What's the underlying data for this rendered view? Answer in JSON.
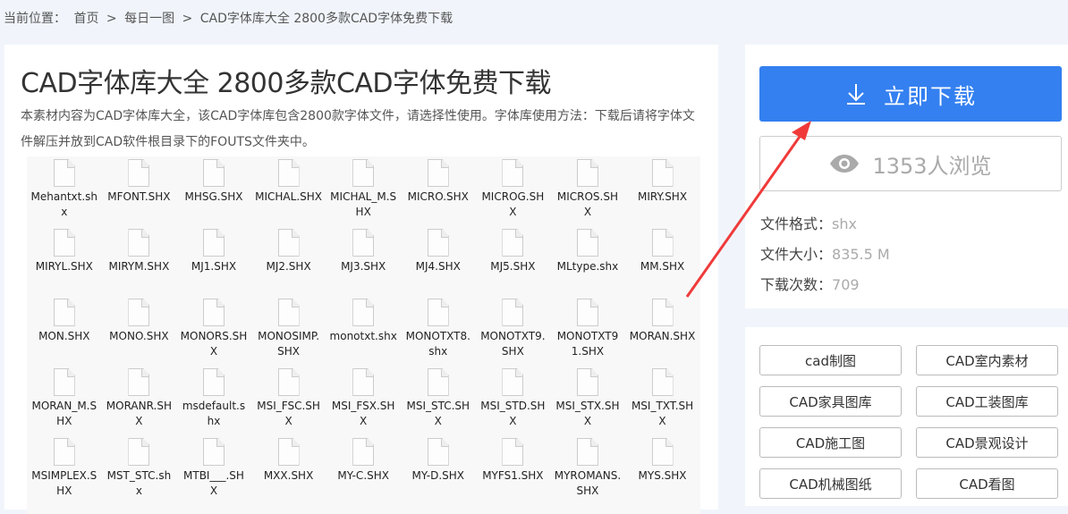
{
  "breadcrumb": {
    "label": "当前位置：",
    "items": [
      "首页",
      "每日一图",
      "CAD字体库大全 2800多款CAD字体免费下载"
    ],
    "separator": ">"
  },
  "article": {
    "title": "CAD字体库大全 2800多款CAD字体免费下载",
    "description": "本素材内容为CAD字体库大全，该CAD字体库包含2800款字体文件，请选择性使用。字体库使用方法：下载后请将字体文件解压并放到CAD软件根目录下的FOUTS文件夹中。",
    "files": [
      "Mehantxt.shx",
      "MFONT.SHX",
      "MHSG.SHX",
      "MICHAL.SHX",
      "MICHAL_M.SHX",
      "MICRO.SHX",
      "MICROG.SHX",
      "MICROS.SHX",
      "MIRY.SHX",
      "MIRYL.SHX",
      "MIRYM.SHX",
      "MJ1.SHX",
      "MJ2.SHX",
      "MJ3.SHX",
      "MJ4.SHX",
      "MJ5.SHX",
      "MLtype.shx",
      "MM.SHX",
      "MON.SHX",
      "MONO.SHX",
      "MONORS.SHX",
      "MONOSIMP.SHX",
      "monotxt.shx",
      "MONOTXT8.shx",
      "MONOTXT9.SHX",
      "MONOTXT91.SHX",
      "MORAN.SHX",
      "MORAN_M.SHX",
      "MORANR.SHX",
      "msdefault.shx",
      "MSI_FSC.SHX",
      "MSI_FSX.SHX",
      "MSI_STC.SHX",
      "MSI_STD.SHX",
      "MSI_STX.SHX",
      "MSI_TXT.SHX",
      "MSIMPLEX.SHX",
      "MST_STC.shx",
      "MTBI___.SHX",
      "MXX.SHX",
      "MY-C.SHX",
      "MY-D.SHX",
      "MYFS1.SHX",
      "MYROMANS.SHX",
      "MYS.SHX"
    ]
  },
  "sidebar": {
    "download_label": "立即下载",
    "views_label": "1353人浏览",
    "format_label": "文件格式：",
    "format_value": "shx",
    "size_label": "文件大小：",
    "size_value": "835.5 M",
    "downloads_label": "下载次数：",
    "downloads_value": "709",
    "tags": [
      "cad制图",
      "CAD室内素材",
      "CAD家具图库",
      "CAD工装图库",
      "CAD施工图",
      "CAD景观设计",
      "CAD机械图纸",
      "CAD看图"
    ]
  },
  "colors": {
    "accent": "#3480f0",
    "arrow": "#f03a3a"
  }
}
